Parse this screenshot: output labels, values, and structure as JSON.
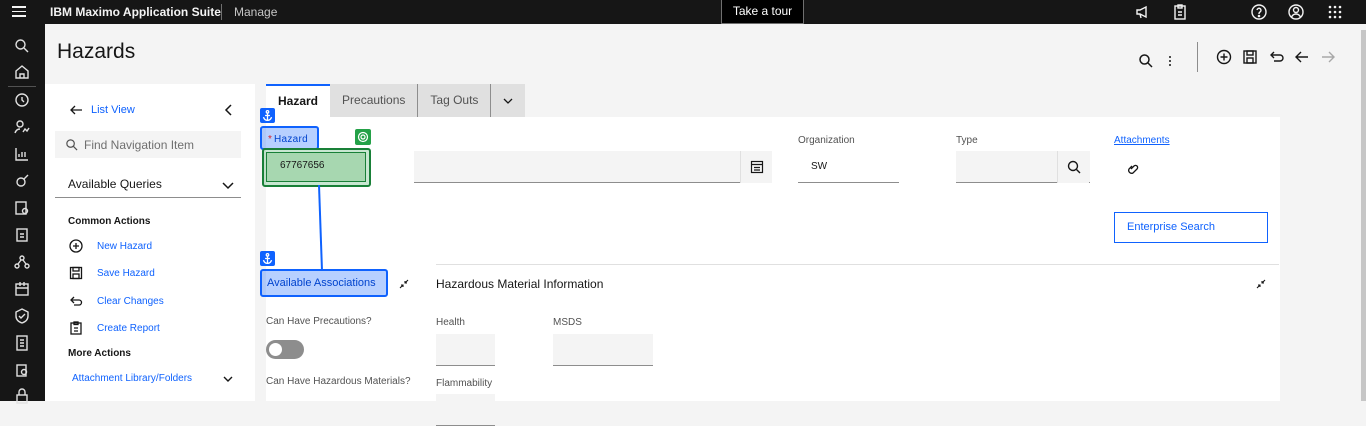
{
  "topbar": {
    "brand": "IBM Maximo Application Suite",
    "app": "Manage",
    "tour": "Take a tour"
  },
  "page": {
    "title": "Hazards"
  },
  "nav": {
    "list_view": "List View",
    "search_placeholder": "Find Navigation Item",
    "queries": "Available Queries",
    "common_actions": "Common Actions",
    "actions": [
      "New Hazard",
      "Save Hazard",
      "Clear Changes",
      "Create Report"
    ],
    "more_actions": "More Actions",
    "attachment_library": "Attachment Library/Folders"
  },
  "tabs": [
    "Hazard",
    "Precautions",
    "Tag Outs"
  ],
  "form": {
    "hazard_required": "*",
    "hazard_label": "Hazard",
    "hazard_value": "67767656",
    "organization_label": "Organization",
    "organization_value": "SW",
    "type_label": "Type",
    "attachments_link": "Attachments",
    "enterprise_search": "Enterprise Search",
    "available_associations": "Available Associations",
    "hazardous_material_info": "Hazardous Material Information",
    "can_have_precautions": "Can Have Precautions?",
    "can_have_hazardous_materials": "Can Have Hazardous Materials?",
    "health_label": "Health",
    "msds_label": "MSDS",
    "flammability_label": "Flammability"
  }
}
